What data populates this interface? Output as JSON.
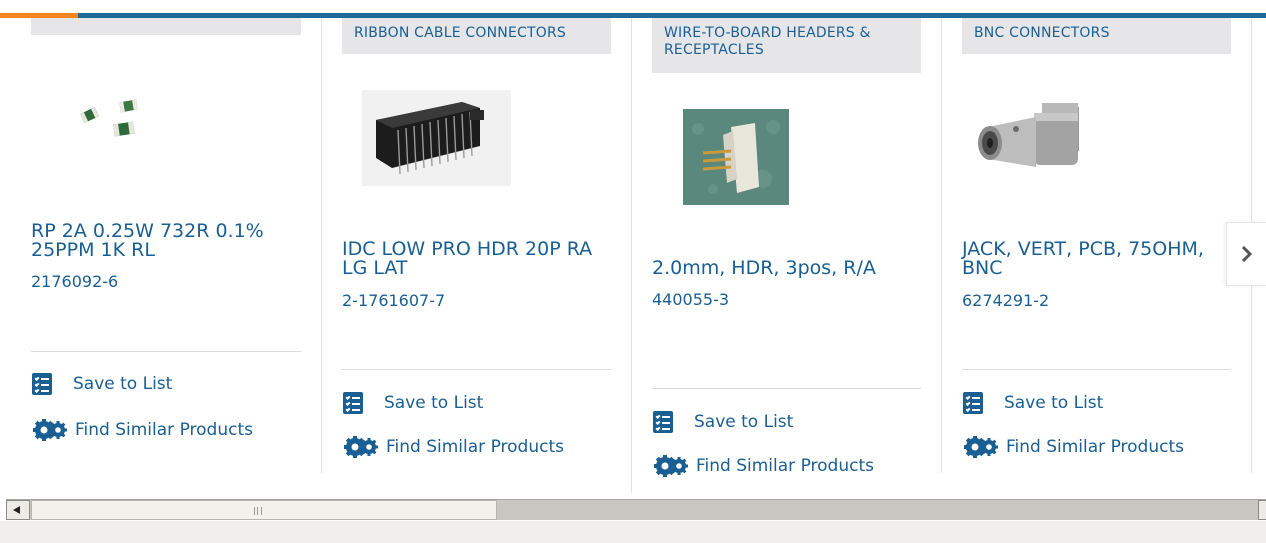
{
  "colors": {
    "brand_blue": "#1a5f93",
    "accent_orange": "#f4851f",
    "category_bg": "#e6e6e9"
  },
  "cards": [
    {
      "category": "",
      "title": "RP 2A 0.25W 732R 0.1% 25PPM 1K RL",
      "part_number": "2176092-6",
      "save_label": "Save to List",
      "similar_label": "Find Similar Products"
    },
    {
      "category": "RIBBON CABLE CONNECTORS",
      "title": "IDC LOW PRO HDR 20P RA LG LAT",
      "part_number": "2-1761607-7",
      "save_label": "Save to List",
      "similar_label": "Find Similar Products"
    },
    {
      "category": "WIRE-TO-BOARD HEADERS & RECEPTACLES",
      "title": "2.0mm, HDR, 3pos, R/A",
      "part_number": "440055-3",
      "save_label": "Save to List",
      "similar_label": "Find Similar Products"
    },
    {
      "category": "BNC CONNECTORS",
      "title": "JACK, VERT, PCB, 75OHM, BNC",
      "part_number": "6274291-2",
      "save_label": "Save to List",
      "similar_label": "Find Similar Products"
    }
  ],
  "icons": {
    "save": "checklist-icon",
    "similar": "gears-icon",
    "next": "chevron-right-icon"
  }
}
